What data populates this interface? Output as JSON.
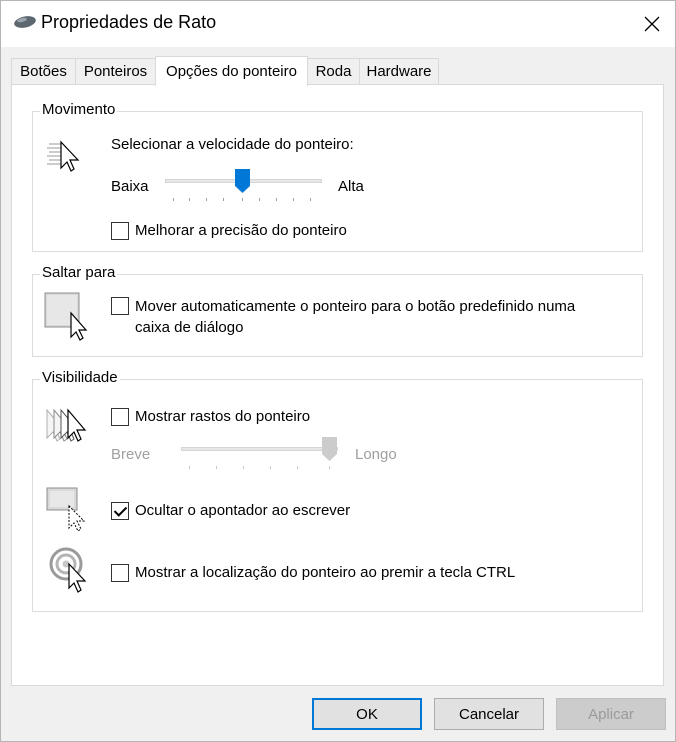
{
  "window": {
    "title": "Propriedades de Rato",
    "close_icon": "close-icon"
  },
  "tabs": [
    {
      "label": "Botões"
    },
    {
      "label": "Ponteiros"
    },
    {
      "label": "Opções do ponteiro",
      "active": true
    },
    {
      "label": "Roda"
    },
    {
      "label": "Hardware"
    }
  ],
  "movimento": {
    "label": "Movimento",
    "speed_label": "Selecionar a velocidade do ponteiro:",
    "slow": "Baixa",
    "fast": "Alta",
    "speed_position": 0.5,
    "precision_label": "Melhorar a precisão do ponteiro",
    "precision_checked": false
  },
  "saltar": {
    "label": "Saltar para",
    "snap_label_line1": "Mover automaticamente o ponteiro para o botão predefinido numa",
    "snap_label_line2": "caixa de diálogo",
    "snap_checked": false
  },
  "visibilidade": {
    "label": "Visibilidade",
    "trails_label": "Mostrar rastos do ponteiro",
    "trails_checked": false,
    "short": "Breve",
    "long": "Longo",
    "trails_position": 1.0,
    "hide_label": "Ocultar o apontador ao escrever",
    "hide_checked": true,
    "ctrl_label": "Mostrar a localização do ponteiro ao premir a tecla CTRL",
    "ctrl_checked": false
  },
  "buttons": {
    "ok": "OK",
    "cancel": "Cancelar",
    "apply": "Aplicar"
  },
  "colors": {
    "accent": "#0078d7",
    "window_bg": "#f0f0f0"
  }
}
